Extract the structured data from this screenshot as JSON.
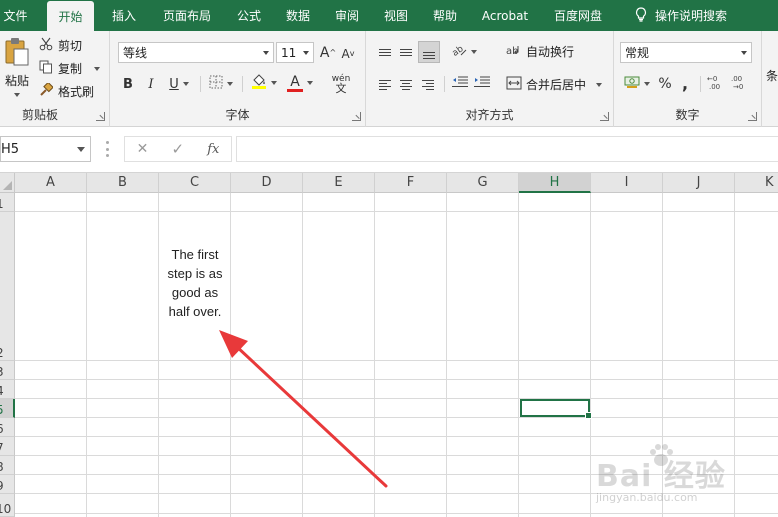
{
  "ribbon_tabs": [
    {
      "label": "文件",
      "active": false
    },
    {
      "label": "开始",
      "active": true
    },
    {
      "label": "插入",
      "active": false
    },
    {
      "label": "页面布局",
      "active": false
    },
    {
      "label": "公式",
      "active": false
    },
    {
      "label": "数据",
      "active": false
    },
    {
      "label": "审阅",
      "active": false
    },
    {
      "label": "视图",
      "active": false
    },
    {
      "label": "帮助",
      "active": false
    },
    {
      "label": "Acrobat",
      "active": false
    },
    {
      "label": "百度网盘",
      "active": false
    },
    {
      "label": "操作说明搜索",
      "active": false
    }
  ],
  "clipboard": {
    "paste_label": "粘贴",
    "cut_label": "剪切",
    "copy_label": "复制",
    "format_painter_label": "格式刷",
    "group_label": "剪贴板"
  },
  "font": {
    "font_name": "等线",
    "font_size": "11",
    "grow_glyph": "A",
    "shrink_glyph": "A",
    "bold_glyph": "B",
    "italic_glyph": "I",
    "underline_glyph": "U",
    "font_color_glyph": "A",
    "phonetic_glyph": "wén",
    "phonetic_sub": "文",
    "group_label": "字体"
  },
  "alignment": {
    "wrap_text_label": "自动换行",
    "merge_center_label": "合并后居中",
    "group_label": "对齐方式"
  },
  "number": {
    "format_value": "常规",
    "percent_glyph": "%",
    "comma_glyph": ",",
    "group_label": "数字"
  },
  "styles": {
    "partial_label": "条"
  },
  "formula_bar": {
    "name_box_value": "H5",
    "cancel_glyph": "✕",
    "enter_glyph": "✓",
    "fx_glyph": "fx",
    "formula_value": ""
  },
  "grid": {
    "columns": [
      "A",
      "B",
      "C",
      "D",
      "E",
      "F",
      "G",
      "H",
      "I",
      "J",
      "K"
    ],
    "active_column": "H",
    "rows": [
      "1",
      "2",
      "3",
      "4",
      "5",
      "6",
      "7",
      "8",
      "9",
      "10"
    ],
    "active_row": "5",
    "cell_c2_lines": [
      "The first",
      "step is as",
      "good as",
      "half over."
    ]
  },
  "watermark": {
    "main_text": "Bai 经验",
    "sub_text": "jingyan.baidu.com"
  },
  "colors": {
    "excel_green": "#217346",
    "ribbon_bg": "#f3f3f3",
    "annotation_red": "#e8393a"
  }
}
